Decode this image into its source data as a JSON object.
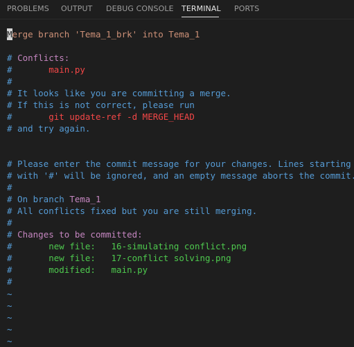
{
  "panel": {
    "tabs": [
      {
        "label": "PROBLEMS"
      },
      {
        "label": "OUTPUT"
      },
      {
        "label": "DEBUG CONSOLE"
      },
      {
        "label": "TERMINAL"
      },
      {
        "label": "PORTS"
      }
    ],
    "active_tab": "TERMINAL"
  },
  "terminal": {
    "colors": {
      "comment": "#569cd6",
      "subject": "#ce9178",
      "section": "#c586c0",
      "highlight": "#f44747",
      "staged": "#4ec94e",
      "background": "#1e1e1e"
    },
    "merge_line": {
      "cursor_char": "M",
      "rest": "erge branch 'Tema_1_brk' into Tema_1"
    },
    "conflicts_header_hash": "# ",
    "conflicts_header": "Conflicts:",
    "conflict_file_hash": "#       ",
    "conflict_file": "main.py",
    "hash": "#",
    "commit_warn_1": "# It looks like you are committing a merge.",
    "commit_warn_2": "# If this is not correct, please run",
    "update_ref_hash": "#       ",
    "update_ref_cmd": "git update-ref -d MERGE_HEAD",
    "try_again": "# and try again.",
    "msg_1": "# Please enter the commit message for your changes. Lines starting",
    "msg_2": "# with '#' will be ignored, and an empty message aborts the commit.",
    "branch_prefix": "# On branch ",
    "branch_name": "Tema_1",
    "all_fixed": "# All conflicts fixed but you are still merging.",
    "changes_hash": "# ",
    "changes_header": "Changes to be committed:",
    "changes": [
      {
        "hash": "#       ",
        "status": "new file:",
        "pad": "   ",
        "file": "16-simulating conflict.png"
      },
      {
        "hash": "#       ",
        "status": "new file:",
        "pad": "   ",
        "file": "17-conflict solving.png"
      },
      {
        "hash": "#       ",
        "status": "modified:",
        "pad": "   ",
        "file": "main.py"
      }
    ],
    "tilde": "~"
  }
}
